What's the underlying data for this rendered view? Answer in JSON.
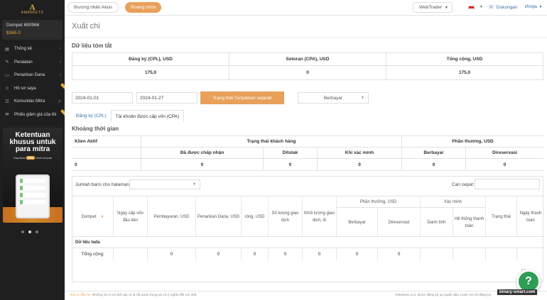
{
  "brand": {
    "logo_letter": "A",
    "logo_text": "AMARKETS"
  },
  "wallet": {
    "name": "Dompet 690966",
    "amount": "$365.0"
  },
  "nav": [
    {
      "label": "Thống kê",
      "icon": "chart-icon",
      "glyph": "▤"
    },
    {
      "label": "Peralatan",
      "icon": "tools-icon",
      "glyph": "✎"
    },
    {
      "label": "Penarikan Dana",
      "icon": "wallet-icon",
      "glyph": "▭"
    },
    {
      "label": "Hồ sơ saya",
      "icon": "user-icon",
      "glyph": "☺"
    },
    {
      "label": "Komunitas Mitra",
      "icon": "community-icon",
      "glyph": "☷"
    },
    {
      "label": "Phiếu giảm giá của tôi",
      "icon": "coupon-icon",
      "glyph": "✉"
    }
  ],
  "banner": {
    "title": "Ketentuan khusus untuk para mitra",
    "sub_prefix": "Dapatkan",
    "sub_pct": "20%",
    "sub_suffix": "lebih banyak"
  },
  "topbar": {
    "tab_trader": "thương nhân Akun",
    "tab_partner": "Ruang mitra",
    "webtrader": "WebTrader",
    "support": "Dukungan",
    "user": "Игорь"
  },
  "page": {
    "title": "Xuất chi",
    "summary_title": "Dữ liệu tóm tắt",
    "period_title": "Khoảng thời gian"
  },
  "summary": {
    "headers": [
      "Đăng ký (CPL), USD",
      "Setoran (CPA), USD",
      "Tổng cộng, USD"
    ],
    "values": [
      "175,0",
      "0",
      "175,0"
    ]
  },
  "filters": {
    "date_from": "2024-01-01",
    "date_to": "2024-01-27",
    "show_history": "Trạng thái Tunjukkan sejarah",
    "paid_select": "Berbayar"
  },
  "subtabs": {
    "cpl": "Đăng ký (CPL)",
    "cpa": "Tài khoản được cấp vốn (CPA)"
  },
  "period": {
    "klien": "Klien Aktif",
    "client_status": "Trạng thái khách hàng",
    "reward": "Phần thưởng, USD",
    "accepted": "Đã được chấp nhận",
    "rejected": "Ditolak",
    "confirm": "Khi xác minh",
    "paid": "Berbayar",
    "reserved": "Direservasi",
    "values": [
      "0",
      "0",
      "0",
      "0",
      "0",
      "0"
    ]
  },
  "table": {
    "rows_label": "Jumlah baris cho halaman",
    "search_label": "Cari cepat:",
    "cols": {
      "wallet": "Dompet",
      "first_funded": "Ngày cấp vốn đầu tiên",
      "payment": "Pembayaran, USD",
      "withdraw": "Penarikan Dana, USD",
      "net": "ròng, USD",
      "trade_count": "Số lượng giao dịch",
      "volume": "Khối lượng giao dịch, lô",
      "reward_group": "Phần thưởng, USD",
      "reward_paid": "Berbayar",
      "reward_reserved": "Direservasi",
      "verify_group": "Xác minh",
      "verify_person": "Danh tính",
      "verify_system": "Hệ thống thanh toán",
      "status": "Trạng thái",
      "pay_time": "Ngày thanh toán"
    },
    "no_data": "Dữ liệu tada",
    "total_label": "Tổng cộng:",
    "total_values": [
      "0",
      "0",
      "0",
      "0",
      "0",
      "0",
      "0"
    ]
  },
  "footer": {
    "risk_label": "Rủi ro đầu tư:",
    "risk_text": "Những rủi ro có thể xảy ra là rất quan trọng và có ý nghĩa đối với nhà",
    "right_text": "AMarkets LLC được đăng ký tại Quần đảo Cook với số đăng ký"
  },
  "watermark": "binary-smart.com",
  "colors": {
    "accent": "#e8a05a",
    "sidebar": "#1f1f1f",
    "link": "#3a6ea5",
    "chat": "#2e9e56"
  }
}
